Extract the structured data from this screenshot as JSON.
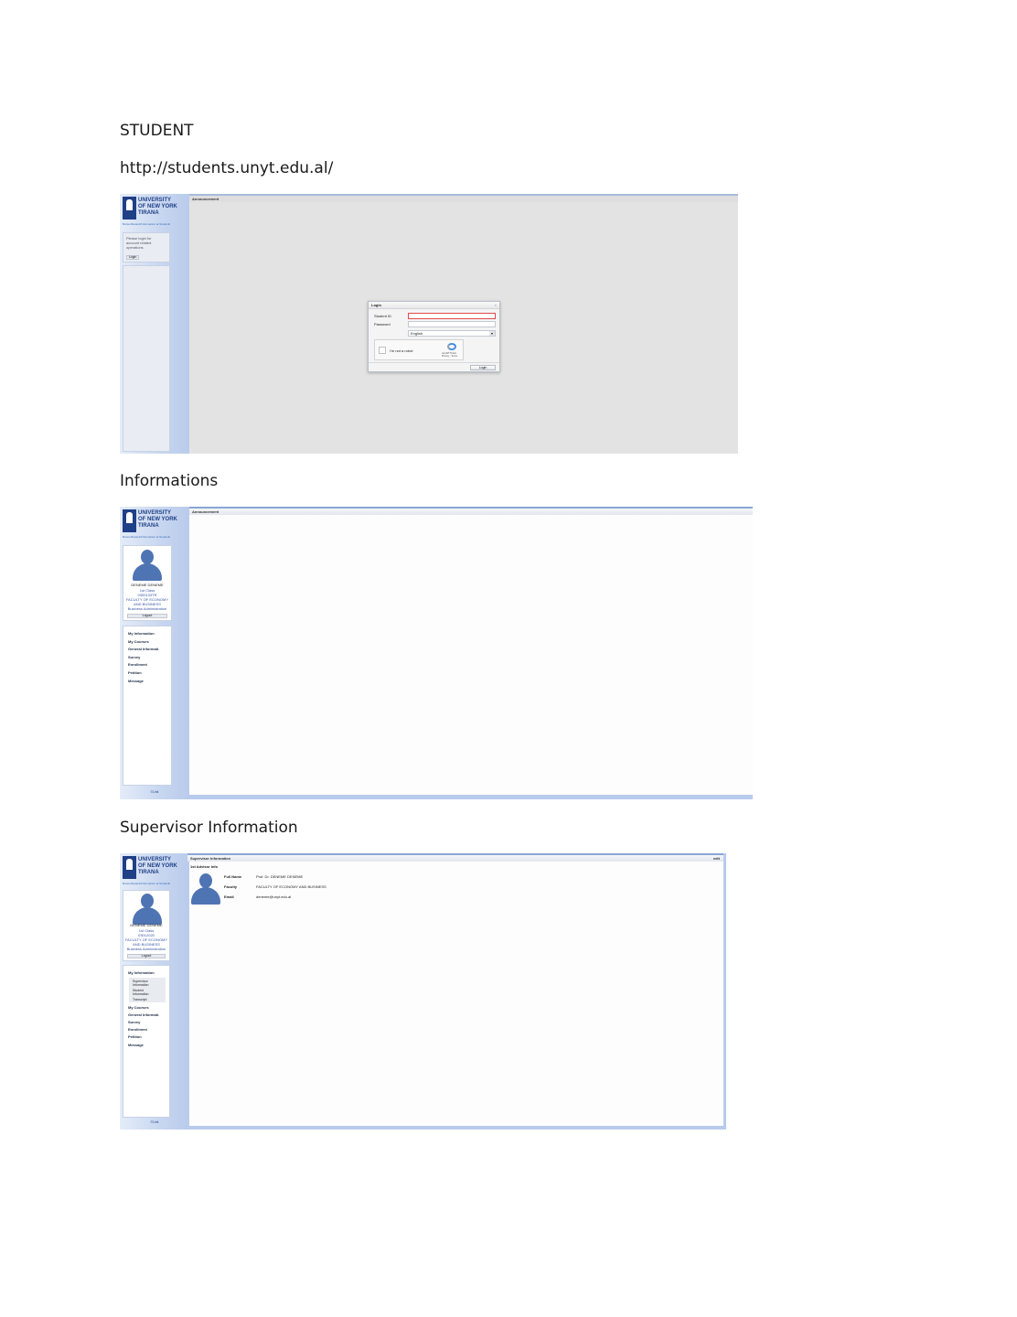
{
  "doc": {
    "heading": "STUDENT",
    "url": "http://students.unyt.edu.al/",
    "section_informations": "Informations",
    "section_supervisor": "Supervisor Information"
  },
  "brand": {
    "logo_text": "UNIVERSITY\nOF NEW YORK\nTIRANA",
    "logo_badge": "UNYT",
    "tagline": "Bursa Mananir/Informacion at Studentit",
    "copyright": "©Unit"
  },
  "login_screen": {
    "main_title": "Announcement",
    "side_note": "Please login for\naccount related\noperations",
    "side_login": "Login",
    "dialog": {
      "title": "Login",
      "close": "×",
      "student_id_label": "Student ID",
      "password_label": "Password",
      "language_value": "English",
      "captcha_label": "I'm not a robot",
      "captcha_brand": "reCAPTCHA",
      "captcha_links": "Privacy - Terms",
      "submit": "Login"
    }
  },
  "student": {
    "name": "DENEME DENEME",
    "class": "1st Class",
    "id": "0300133TR",
    "id2": "03012020",
    "faculty": "FACULTY OF ECONOMY\nAND BUSINESS",
    "program": "Business Administration",
    "logout": "Logout"
  },
  "info_screen": {
    "main_title": "Announcement",
    "menu": [
      "My Information",
      "My Courses",
      "General Informati.",
      "Survey",
      "Enrollment",
      "Petition",
      "Message"
    ]
  },
  "supervisor_screen": {
    "main_title": "Supervisor Information",
    "edit": "edit",
    "section": "1st Advisor Info",
    "rows": [
      {
        "label": "Full Name",
        "value": "Prof. Dr. DENEME DENEME"
      },
      {
        "label": "Faculty",
        "value": "FACULTY OF ECONOMY AND BUSINESS"
      },
      {
        "label": "Email",
        "value": "deneme@unyt.edu.al"
      }
    ],
    "menu_top": "My Information",
    "submenu": [
      "Supervisor\nInformation",
      "Student\nInformation",
      "Transcript"
    ],
    "menu": [
      "My Courses",
      "General Informati.",
      "Survey",
      "Enrollment",
      "Petition",
      "Message"
    ]
  }
}
